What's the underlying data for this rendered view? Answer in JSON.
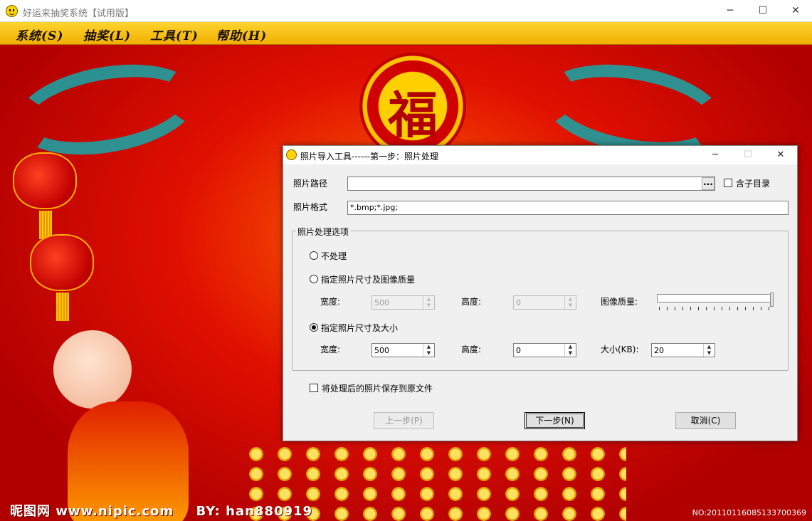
{
  "window": {
    "title": "好运来抽奖系统【试用版】",
    "minimize_glyph": "─",
    "maximize_glyph": "☐",
    "close_glyph": "✕"
  },
  "menu": {
    "items": [
      "系统(S)",
      "抽奖(L)",
      "工具(T)",
      "帮助(H)"
    ]
  },
  "background": {
    "fu_char": "福",
    "watermark_site": "昵图网 www.nipic.com",
    "watermark_by": "BY: han880919",
    "image_no": "NO:20110116085133700369"
  },
  "dialog": {
    "title": "照片导入工具------第一步：照片处理",
    "minimize_glyph": "─",
    "maximize_glyph": "☐",
    "close_glyph": "✕",
    "path_label": "照片路径",
    "path_value": "",
    "browse_label": "...",
    "include_subdir_label": "含子目录",
    "format_label": "照片格式",
    "format_value": "*.bmp;*.jpg;",
    "options_group_title": "照片处理选项",
    "opt_none_label": "不处理",
    "opt_size_quality_label": "指定照片尺寸及图像质量",
    "opt_size_filesize_label": "指定照片尺寸及大小",
    "width_label": "宽度:",
    "height_label": "高度:",
    "quality_label": "图像质量:",
    "filesize_label": "大小(KB):",
    "sq_width_value": "500",
    "sq_height_value": "0",
    "sf_width_value": "500",
    "sf_height_value": "0",
    "sf_size_value": "20",
    "quality_level_fraction": 1.0,
    "save_original_label": "将处理后的照片保存到原文件",
    "prev_button": "上一步(P)",
    "next_button": "下一步(N)",
    "cancel_button": "取消(C)"
  },
  "icons": {
    "app": "smiley-icon",
    "dialog": "smiley-icon",
    "spin_up": "▲",
    "spin_down": "▼"
  }
}
